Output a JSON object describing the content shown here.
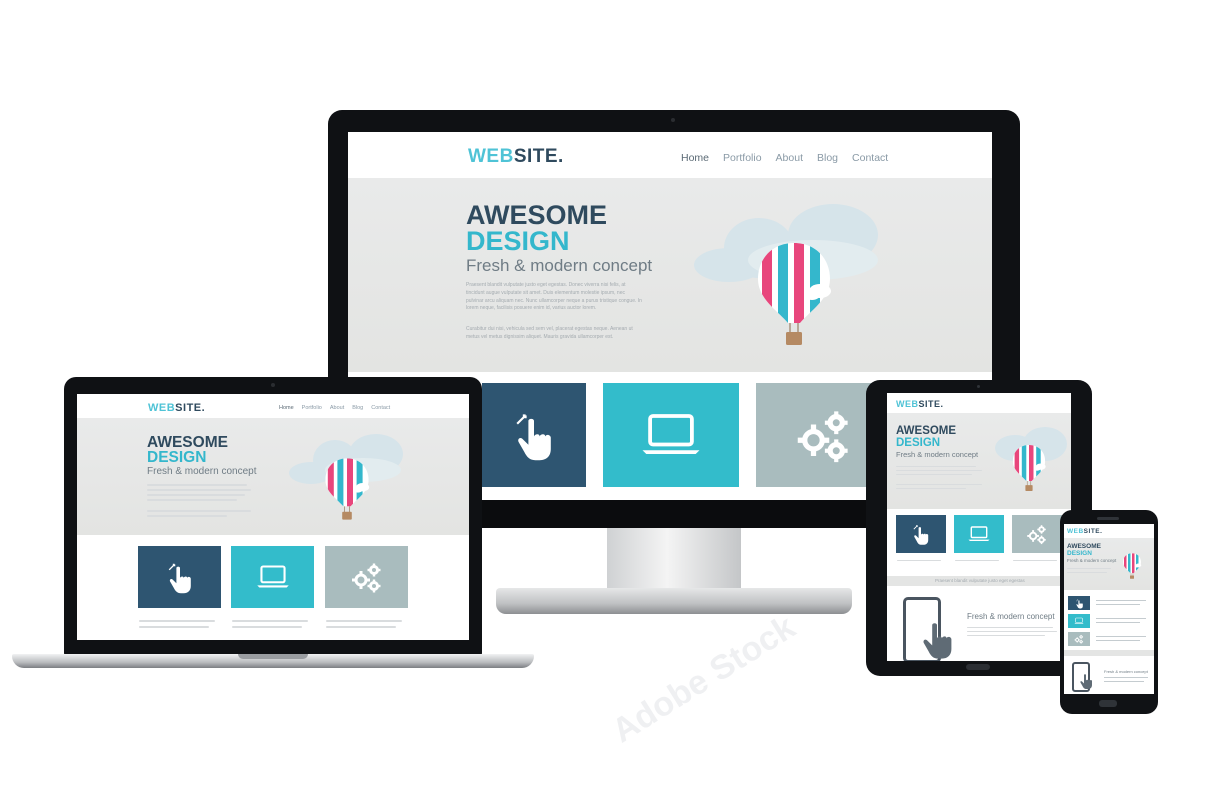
{
  "site": {
    "logo_web": "WEB",
    "logo_site": "SITE.",
    "nav": [
      "Home",
      "Portfolio",
      "About",
      "Blog",
      "Contact"
    ],
    "headline_1": "AWESOME",
    "headline_2": "DESIGN",
    "subtitle": "Fresh & modern concept",
    "paragraph_1": "Praesent blandit vulputate justo eget egestas. Donec viverra nisi felis, at tincidunt augue vulputate sit amet. Duis elementum molestie ipsum, nec pulvinar arcu aliquam nec. Nunc ullamcorper neque a purus tristique congue. In lorem neque, facilisis posuere enim id, varius auctor lorem.",
    "paragraph_2": "Curabitur dui nisi, vehicula sed sem vel, placerat egestas neque. Aenean ut metus vel metus dignissim aliquet. Mauris gravida ullamcorper est.",
    "tablet_strip": "Praesent blandit vulputate justo eget egestas"
  },
  "watermark": "Adobe Stock",
  "colors": {
    "navy": "#2e5571",
    "teal": "#33bccb",
    "gray": "#a9bcbe",
    "pink": "#e8467c",
    "bezel": "#101215"
  },
  "icons": [
    "touch-hand-icon",
    "laptop-icon",
    "gears-icon",
    "hot-air-balloon-icon",
    "cloud-icon"
  ]
}
